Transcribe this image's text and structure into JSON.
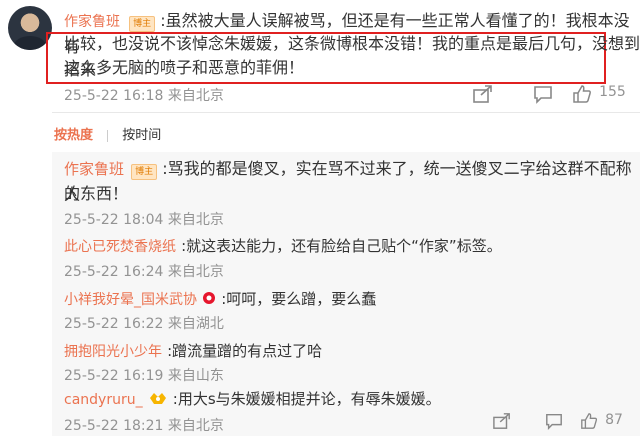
{
  "main_comment": {
    "user": "作家鲁班",
    "badge": "博主",
    "line1": ":虽然被大量人误解被骂，但还是有一些正常人看懂了的！我根本没有",
    "line2": "比较，也没说不该悼念朱媛媛，这条微博根本没错！我的重点是最后几句，没想到招来",
    "line3": "这么多无脑的喷子和恶意的菲佣！",
    "timestamp": "25-5-22 16:18 来自北京",
    "like_count": "155"
  },
  "sort_bar": {
    "hot": "按热度",
    "time": "按时间"
  },
  "replies": [
    {
      "user": "作家鲁班",
      "badge": "博主",
      "text1": ":骂我的都是傻叉，实在骂不过来了，统一送傻叉二字给这群不配称人",
      "text2": "的东西！",
      "timestamp": "25-5-22 18:04 来自北京"
    },
    {
      "user": "此心已死焚香烧纸",
      "text1": ":就这表达能力，还有脸给自己贴个“作家”标签。",
      "timestamp": "25-5-22 16:24 来自北京"
    },
    {
      "user": "小祥我好晕_国米武协",
      "text1": ":呵呵，要么蹭，要么蠢",
      "timestamp": "25-5-22 16:22 来自湖北"
    },
    {
      "user": "拥抱阳光小少年",
      "text1": ":蹭流量蹭的有点过了哈",
      "timestamp": "25-5-22 16:19 来自山东"
    },
    {
      "user": "candyruru_",
      "text1": ":用大s与朱媛媛相提并论，有辱朱媛媛。",
      "timestamp": "25-5-22 18:21 来自北京",
      "like_count": "87"
    }
  ],
  "colors": {
    "username": "#eb7350",
    "highlight_box": "#e02020",
    "meta_text": "#939393"
  },
  "icons": [
    "share-icon",
    "comment-icon",
    "like-icon",
    "weibo-badge-icon",
    "fan-badge-icon"
  ]
}
